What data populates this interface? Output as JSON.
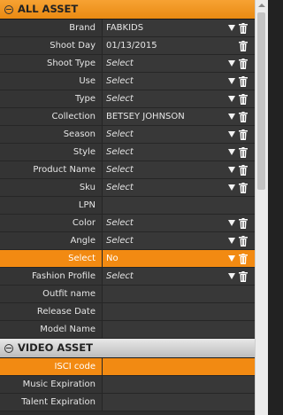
{
  "sections": {
    "all_asset": {
      "title": "ALL ASSET"
    },
    "video_asset": {
      "title": "VIDEO ASSET"
    }
  },
  "rows": [
    {
      "label": "Brand",
      "value": "FABKIDS"
    },
    {
      "label": "Shoot Day",
      "value": "01/13/2015"
    },
    {
      "label": "Shoot Type",
      "value": "Select"
    },
    {
      "label": "Use",
      "value": "Select"
    },
    {
      "label": "Type",
      "value": "Select"
    },
    {
      "label": "Collection",
      "value": "BETSEY JOHNSON"
    },
    {
      "label": "Season",
      "value": "Select"
    },
    {
      "label": "Style",
      "value": "Select"
    },
    {
      "label": "Product Name",
      "value": "Select"
    },
    {
      "label": "Sku",
      "value": "Select"
    },
    {
      "label": "LPN",
      "value": ""
    },
    {
      "label": "Color",
      "value": "Select"
    },
    {
      "label": "Angle",
      "value": "Select"
    },
    {
      "label": "Select",
      "value": "No"
    },
    {
      "label": "Fashion Profile",
      "value": "Select"
    },
    {
      "label": "Outfit name",
      "value": ""
    },
    {
      "label": "Release Date",
      "value": ""
    },
    {
      "label": "Model Name",
      "value": ""
    }
  ],
  "video_rows": [
    {
      "label": "ISCI code",
      "value": ""
    },
    {
      "label": "Music Expiration",
      "value": ""
    },
    {
      "label": "Talent Expiration",
      "value": ""
    }
  ],
  "colors": {
    "accent": "#f28a12",
    "header_gray": "#d0d0d0"
  },
  "icons": {
    "collapse": "minus-circle-icon",
    "dropdown": "triangle-down-icon",
    "delete": "trash-icon"
  }
}
